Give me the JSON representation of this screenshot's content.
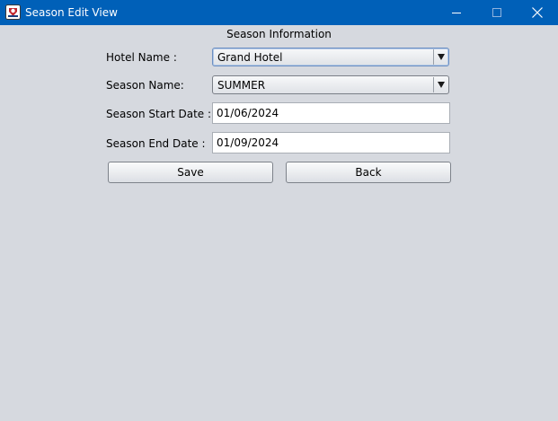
{
  "window": {
    "title": "Season Edit View",
    "icon": "java-app-icon",
    "controls": {
      "minimize_icon": "minimize-icon",
      "maximize_icon": "maximize-icon",
      "close_icon": "close-icon"
    }
  },
  "form": {
    "section_title": "Season Information",
    "hotel_name_label": "Hotel Name :",
    "hotel_name_value": "Grand Hotel",
    "season_name_label": "Season Name:",
    "season_name_value": "SUMMER",
    "start_date_label": "Season Start Date :",
    "start_date_value": "01/06/2024",
    "end_date_label": "Season End Date :",
    "end_date_value": "01/09/2024",
    "save_label": "Save",
    "back_label": "Back"
  },
  "colors": {
    "titlebar": "#0060b8",
    "background": "#d6d9df"
  }
}
